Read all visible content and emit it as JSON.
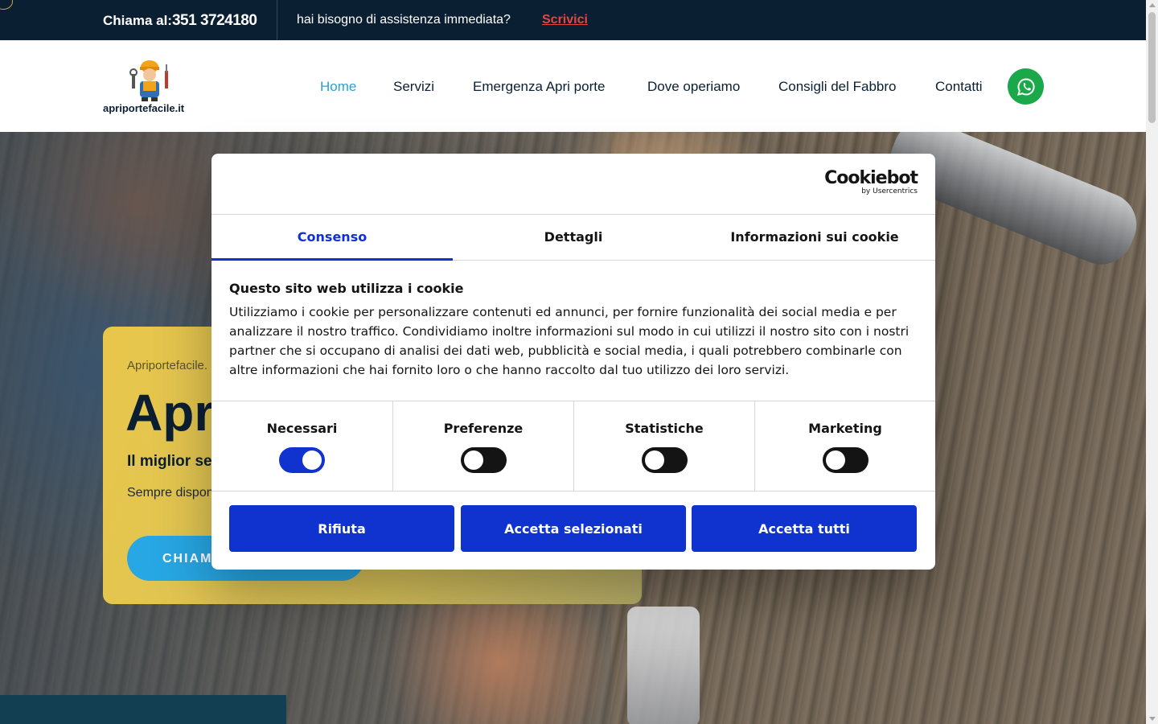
{
  "topbar": {
    "call_label": "Chiama al:",
    "phone": "351 3724180",
    "help_text": "hai bisogno di assistenza immediata?",
    "write_link": "Scrivici"
  },
  "header": {
    "brand": "apriportefacile.it",
    "nav": [
      {
        "label": "Home",
        "active": true
      },
      {
        "label": "Servizi"
      },
      {
        "label": "Emergenza Apri porte"
      },
      {
        "label": "Dove operiamo"
      },
      {
        "label": "Consigli del Fabbro"
      },
      {
        "label": "Contatti"
      }
    ],
    "whatsapp_icon": "whatsapp-icon"
  },
  "hero": {
    "breadcrumb": "Apriportefacile.",
    "title": "Apr",
    "subtitle": "Il miglior se",
    "availability": "Sempre dispon",
    "cta": "CHIAMA"
  },
  "cookie_dialog": {
    "logo": "Cookiebot",
    "logo_by": "by Usercentrics",
    "tabs": [
      "Consenso",
      "Dettagli",
      "Informazioni sui cookie"
    ],
    "active_tab": "Consenso",
    "heading": "Questo sito web utilizza i cookie",
    "body": "Utilizziamo i cookie per personalizzare contenuti ed annunci, per fornire funzionalità dei social media e per analizzare il nostro traffico. Condividiamo inoltre informazioni sul modo in cui utilizzi il nostro sito con i nostri partner che si occupano di analisi dei dati web, pubblicità e social media, i quali potrebbero combinarle con altre informazioni che hai fornito loro o che hanno raccolto dal tuo utilizzo dei loro servizi.",
    "categories": [
      {
        "label": "Necessari",
        "enabled": true
      },
      {
        "label": "Preferenze",
        "enabled": false
      },
      {
        "label": "Statistiche",
        "enabled": false
      },
      {
        "label": "Marketing",
        "enabled": false
      }
    ],
    "buttons": {
      "reject": "Rifiuta",
      "accept_selected": "Accetta selezionati",
      "accept_all": "Accetta tutti"
    }
  },
  "colors": {
    "topbar_bg": "#0b1f33",
    "accent_link": "#e4463f",
    "nav_active": "#2a9fd8",
    "whatsapp": "#1aa84a",
    "cookie_primary": "#1032cf",
    "card_yellow": "#e8c64a",
    "cta_blue": "#27a7e4"
  }
}
